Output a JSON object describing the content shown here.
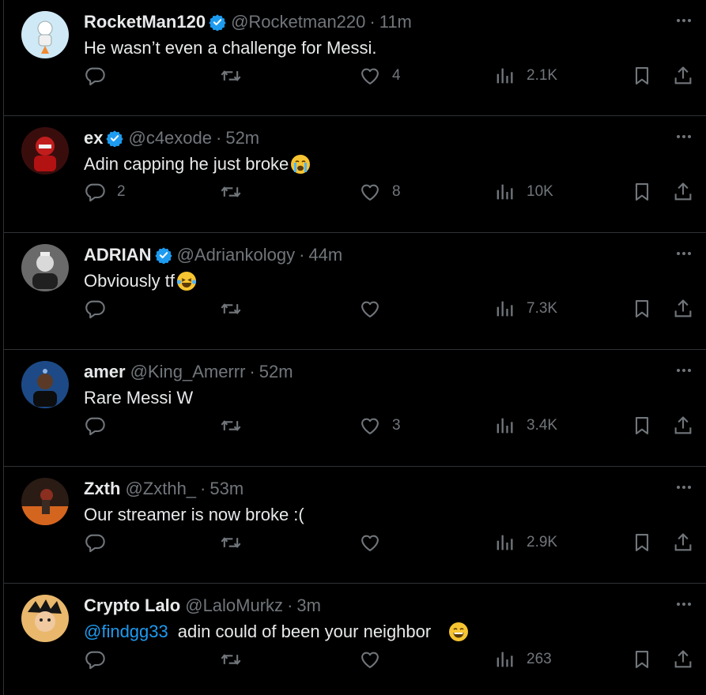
{
  "colors": {
    "background": "#000000",
    "text": "#e7e9ea",
    "muted": "#71767b",
    "verified": "#1d9bf0",
    "link": "#1d9bf0",
    "divider": "#2f3336"
  },
  "icons": {
    "reply": "reply-icon",
    "retweet": "retweet-icon",
    "like": "heart-icon",
    "views": "views-icon",
    "bookmark": "bookmark-icon",
    "share": "share-icon",
    "more": "more-icon",
    "verified": "verified-badge-icon"
  },
  "tweets": [
    {
      "name": "RocketMan120",
      "verified": true,
      "handle": "@Rocketman220",
      "time": "11m",
      "mention": "",
      "text": "He wasn’t even a challenge for Messi.",
      "emoji": "",
      "replies": "",
      "retweets": "",
      "likes": "4",
      "views": "2.1K"
    },
    {
      "name": "ex",
      "verified": true,
      "handle": "@c4exode",
      "time": "52m",
      "mention": "",
      "text": "Adin capping he just broke",
      "emoji": "crying-face",
      "replies": "2",
      "retweets": "",
      "likes": "8",
      "views": "10K"
    },
    {
      "name": "ADRIAN",
      "verified": true,
      "handle": "@Adriankology",
      "time": "44m",
      "mention": "",
      "text": "Obviously tf",
      "emoji": "tears-of-joy",
      "replies": "",
      "retweets": "",
      "likes": "",
      "views": "7.3K"
    },
    {
      "name": "amer",
      "verified": false,
      "handle": "@King_Amerrr",
      "time": "52m",
      "mention": "",
      "text": "Rare Messi W",
      "emoji": "",
      "replies": "",
      "retweets": "",
      "likes": "3",
      "views": "3.4K"
    },
    {
      "name": "Zxth",
      "verified": false,
      "handle": "@Zxthh_",
      "time": "53m",
      "mention": "",
      "text": "Our streamer is now broke :(",
      "emoji": "",
      "replies": "",
      "retweets": "",
      "likes": "",
      "views": "2.9K"
    },
    {
      "name": "Crypto Lalo",
      "verified": false,
      "handle": "@LaloMurkz",
      "time": "3m",
      "mention": "@findgg33",
      "text": "adin could of been your neighbor",
      "emoji": "grinning-face",
      "replies": "",
      "retweets": "",
      "likes": "",
      "views": "263"
    }
  ]
}
